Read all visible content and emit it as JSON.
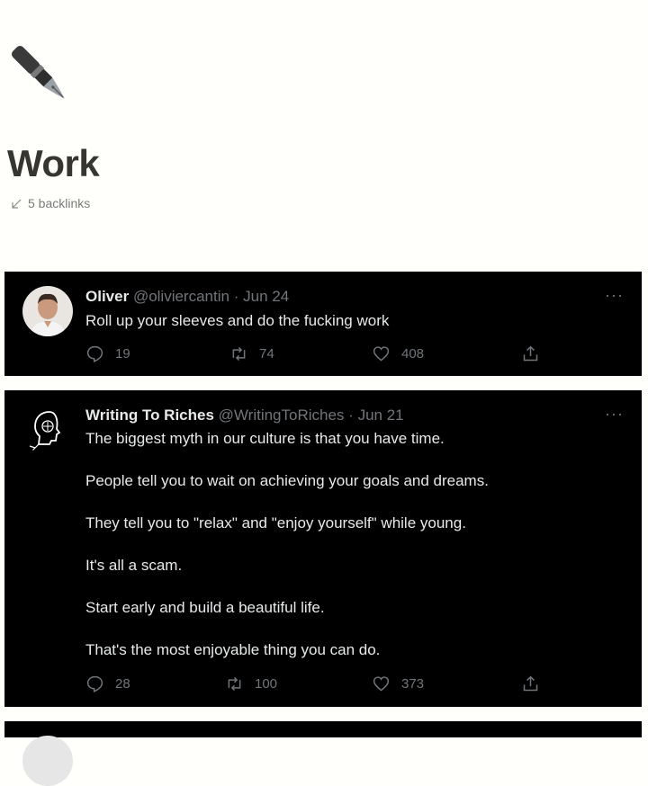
{
  "page": {
    "icon": "fountain-pen-icon",
    "title": "Work",
    "backlinks_label": "5 backlinks"
  },
  "tweets": [
    {
      "name": "Oliver",
      "handle": "@oliviercantin",
      "separator": "·",
      "date": "Jun 24",
      "text": [
        "Roll up your sleeves and do the fucking work"
      ],
      "replies": "19",
      "retweets": "74",
      "likes": "408"
    },
    {
      "name": "Writing To Riches",
      "handle": "@WritingToRiches",
      "separator": "·",
      "date": "Jun 21",
      "text": [
        "The biggest myth in our culture is that you have time.",
        "People tell you to wait on achieving your goals and dreams.",
        "They tell you to \"relax\" and \"enjoy yourself\" while young.",
        "It's all a scam.",
        "Start early and build a beautiful life.",
        "That's the most enjoyable thing you can do."
      ],
      "replies": "28",
      "retweets": "100",
      "likes": "373"
    }
  ],
  "more_label": "···"
}
